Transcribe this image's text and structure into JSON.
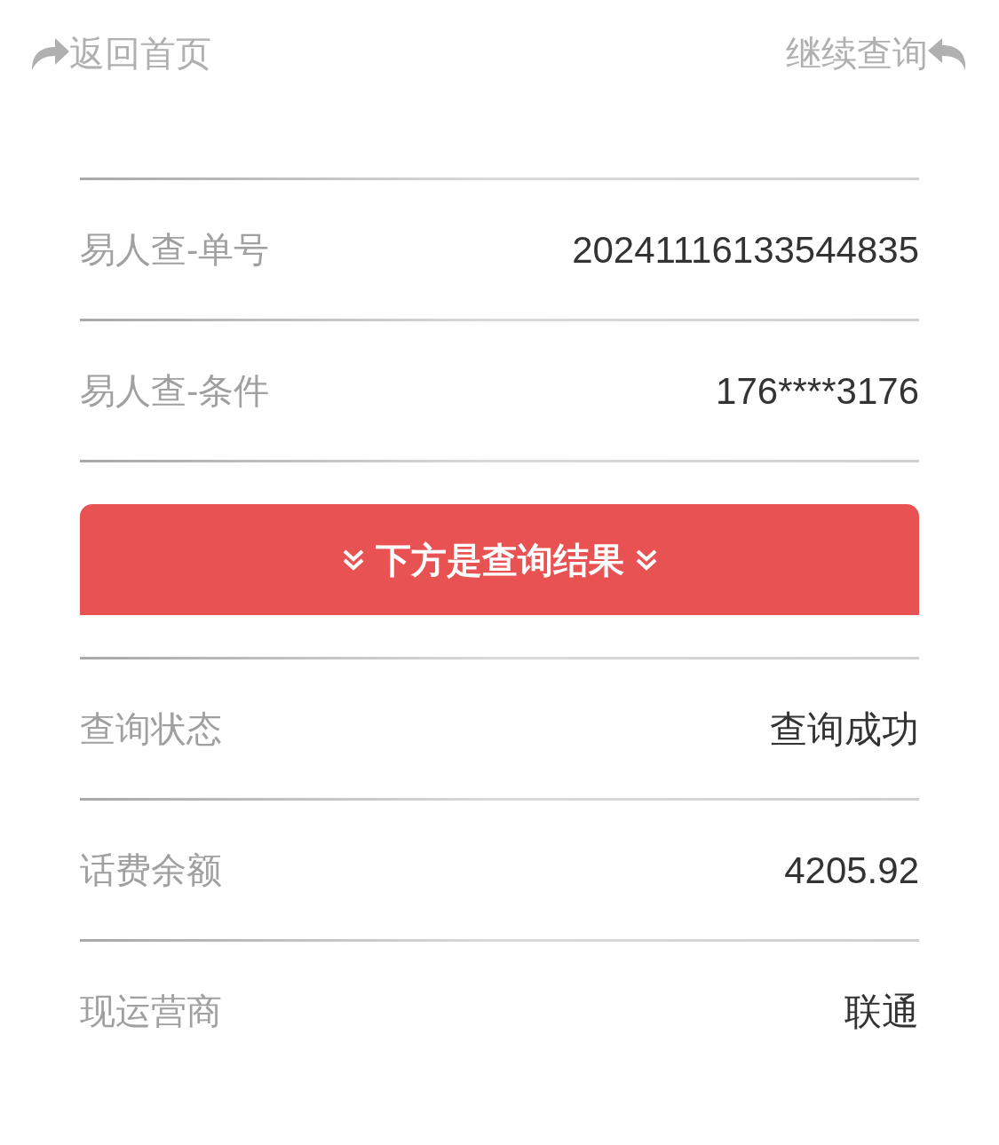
{
  "nav": {
    "back": "返回首页",
    "continue": "继续查询"
  },
  "query_rows": [
    {
      "label": "易人查-单号",
      "value": "20241116133544835"
    },
    {
      "label": "易人查-条件",
      "value": "176****3176"
    }
  ],
  "banner": "下方是查询结果",
  "result_rows": [
    {
      "label": "查询状态",
      "value": "查询成功"
    },
    {
      "label": "话费余额",
      "value": "4205.92"
    },
    {
      "label": "现运营商",
      "value": "联通"
    }
  ]
}
